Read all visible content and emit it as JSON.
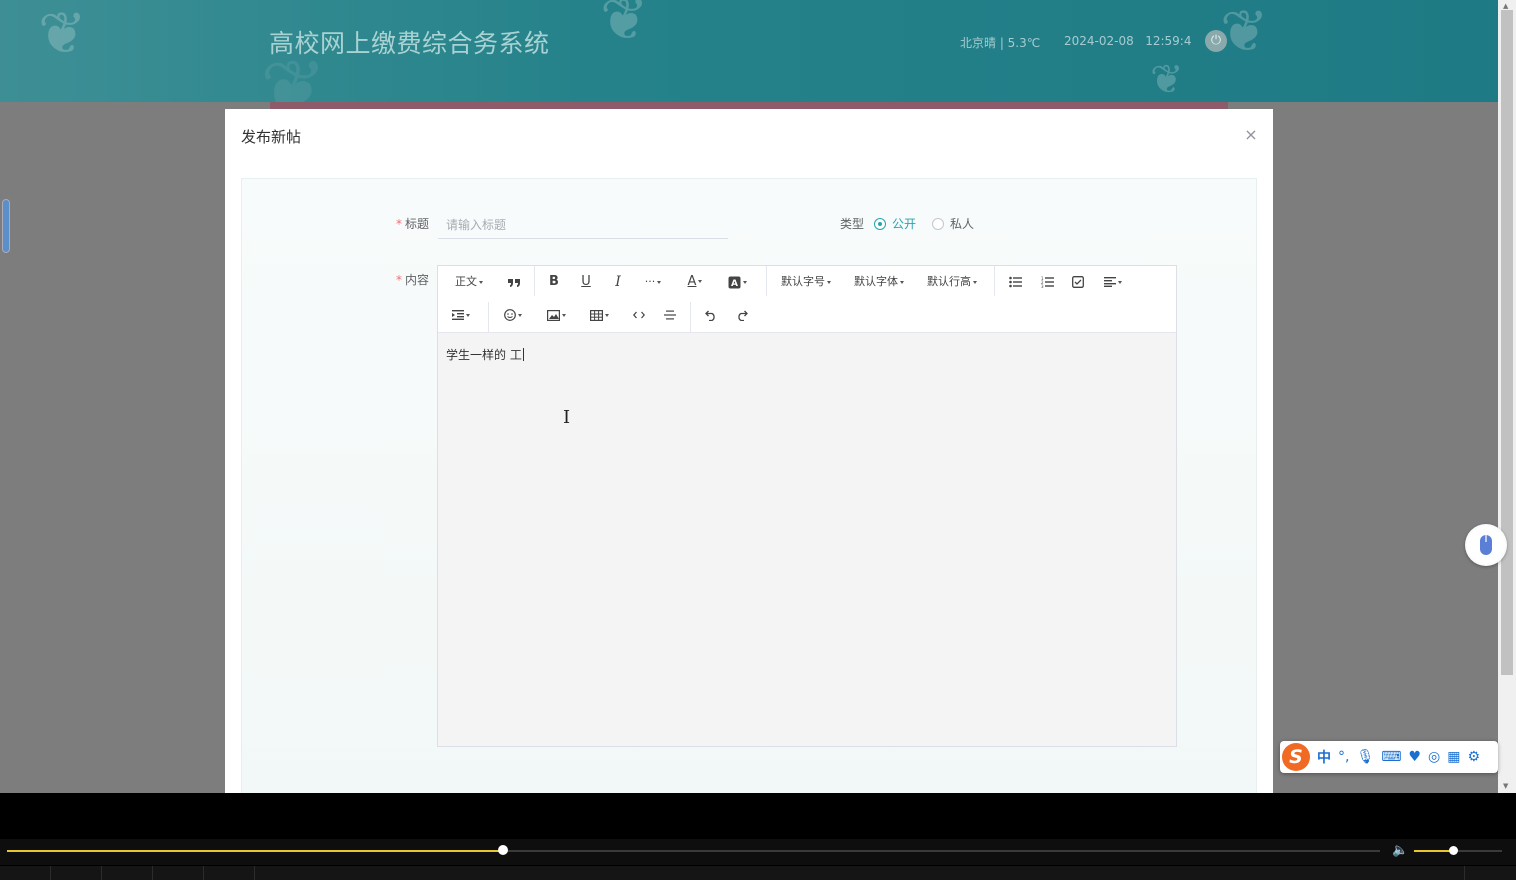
{
  "header": {
    "app_title": "高校网上缴费综合务系统",
    "weather": "北京晴 | 5.3℃",
    "date": "2024-02-08",
    "time": "12:59:4"
  },
  "dialog": {
    "title": "发布新帖",
    "close_symbol": "×"
  },
  "form": {
    "required_mark": "*",
    "title_label": "标题",
    "title_placeholder": "请输入标题",
    "title_value": "",
    "type_label": "类型",
    "type_options": [
      {
        "label": "公开",
        "checked": true
      },
      {
        "label": "私人",
        "checked": false
      }
    ],
    "content_label": "内容",
    "content_text": "学生一样的 工"
  },
  "toolbar": {
    "row1": {
      "paragraph": "正文",
      "font_size": "默认字号",
      "font_family": "默认字体",
      "line_height": "默认行高"
    }
  },
  "colors": {
    "accent": "#26a5b0",
    "header_bg": "#25828a",
    "required": "#f56c6c",
    "progress": "#e8c630"
  },
  "player": {
    "progress": 0.361,
    "volume": 0.44
  },
  "ime": {
    "mode": "中"
  }
}
